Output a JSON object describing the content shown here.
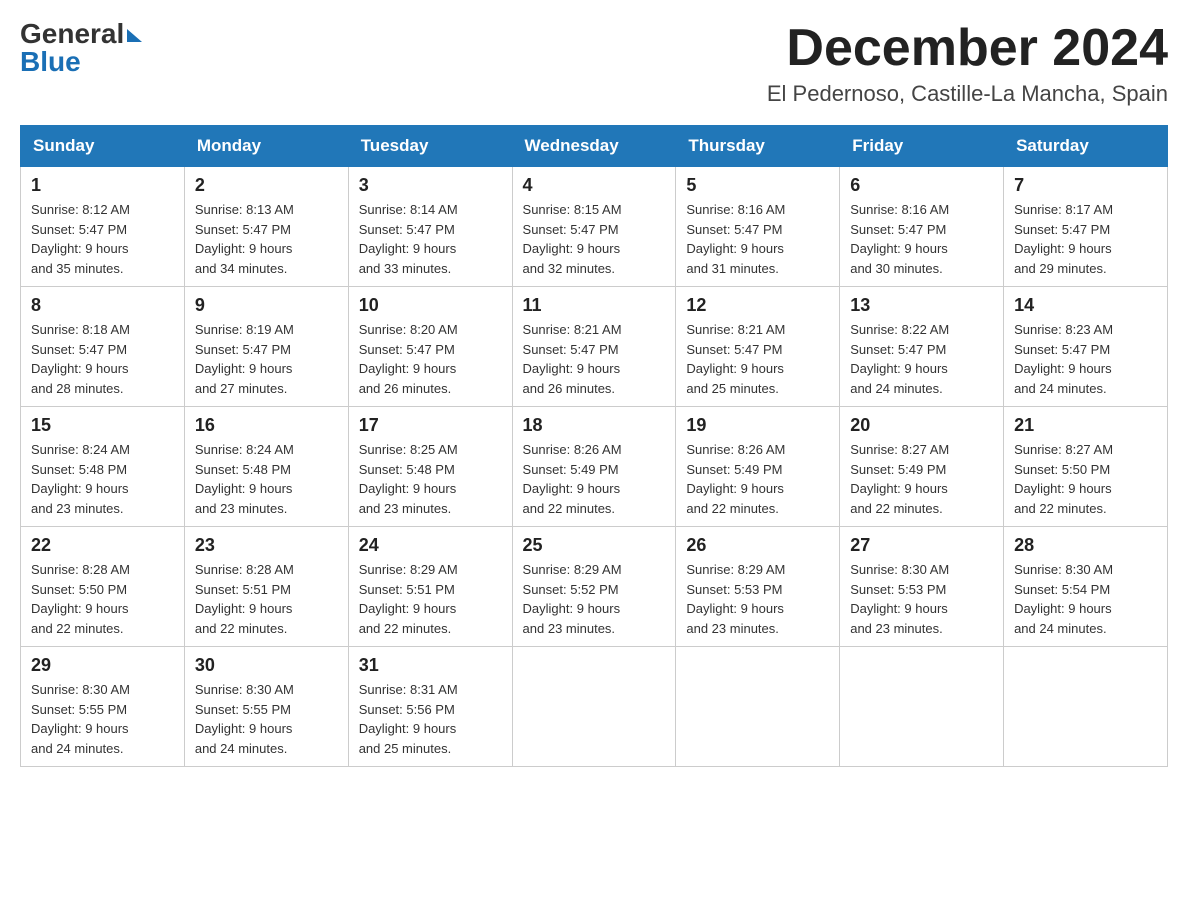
{
  "header": {
    "logo_general": "General",
    "logo_blue": "Blue",
    "month_title": "December 2024",
    "location": "El Pedernoso, Castille-La Mancha, Spain"
  },
  "days_of_week": [
    "Sunday",
    "Monday",
    "Tuesday",
    "Wednesday",
    "Thursday",
    "Friday",
    "Saturday"
  ],
  "weeks": [
    [
      {
        "day": "1",
        "sunrise": "8:12 AM",
        "sunset": "5:47 PM",
        "daylight": "9 hours and 35 minutes."
      },
      {
        "day": "2",
        "sunrise": "8:13 AM",
        "sunset": "5:47 PM",
        "daylight": "9 hours and 34 minutes."
      },
      {
        "day": "3",
        "sunrise": "8:14 AM",
        "sunset": "5:47 PM",
        "daylight": "9 hours and 33 minutes."
      },
      {
        "day": "4",
        "sunrise": "8:15 AM",
        "sunset": "5:47 PM",
        "daylight": "9 hours and 32 minutes."
      },
      {
        "day": "5",
        "sunrise": "8:16 AM",
        "sunset": "5:47 PM",
        "daylight": "9 hours and 31 minutes."
      },
      {
        "day": "6",
        "sunrise": "8:16 AM",
        "sunset": "5:47 PM",
        "daylight": "9 hours and 30 minutes."
      },
      {
        "day": "7",
        "sunrise": "8:17 AM",
        "sunset": "5:47 PM",
        "daylight": "9 hours and 29 minutes."
      }
    ],
    [
      {
        "day": "8",
        "sunrise": "8:18 AM",
        "sunset": "5:47 PM",
        "daylight": "9 hours and 28 minutes."
      },
      {
        "day": "9",
        "sunrise": "8:19 AM",
        "sunset": "5:47 PM",
        "daylight": "9 hours and 27 minutes."
      },
      {
        "day": "10",
        "sunrise": "8:20 AM",
        "sunset": "5:47 PM",
        "daylight": "9 hours and 26 minutes."
      },
      {
        "day": "11",
        "sunrise": "8:21 AM",
        "sunset": "5:47 PM",
        "daylight": "9 hours and 26 minutes."
      },
      {
        "day": "12",
        "sunrise": "8:21 AM",
        "sunset": "5:47 PM",
        "daylight": "9 hours and 25 minutes."
      },
      {
        "day": "13",
        "sunrise": "8:22 AM",
        "sunset": "5:47 PM",
        "daylight": "9 hours and 24 minutes."
      },
      {
        "day": "14",
        "sunrise": "8:23 AM",
        "sunset": "5:47 PM",
        "daylight": "9 hours and 24 minutes."
      }
    ],
    [
      {
        "day": "15",
        "sunrise": "8:24 AM",
        "sunset": "5:48 PM",
        "daylight": "9 hours and 23 minutes."
      },
      {
        "day": "16",
        "sunrise": "8:24 AM",
        "sunset": "5:48 PM",
        "daylight": "9 hours and 23 minutes."
      },
      {
        "day": "17",
        "sunrise": "8:25 AM",
        "sunset": "5:48 PM",
        "daylight": "9 hours and 23 minutes."
      },
      {
        "day": "18",
        "sunrise": "8:26 AM",
        "sunset": "5:49 PM",
        "daylight": "9 hours and 22 minutes."
      },
      {
        "day": "19",
        "sunrise": "8:26 AM",
        "sunset": "5:49 PM",
        "daylight": "9 hours and 22 minutes."
      },
      {
        "day": "20",
        "sunrise": "8:27 AM",
        "sunset": "5:49 PM",
        "daylight": "9 hours and 22 minutes."
      },
      {
        "day": "21",
        "sunrise": "8:27 AM",
        "sunset": "5:50 PM",
        "daylight": "9 hours and 22 minutes."
      }
    ],
    [
      {
        "day": "22",
        "sunrise": "8:28 AM",
        "sunset": "5:50 PM",
        "daylight": "9 hours and 22 minutes."
      },
      {
        "day": "23",
        "sunrise": "8:28 AM",
        "sunset": "5:51 PM",
        "daylight": "9 hours and 22 minutes."
      },
      {
        "day": "24",
        "sunrise": "8:29 AM",
        "sunset": "5:51 PM",
        "daylight": "9 hours and 22 minutes."
      },
      {
        "day": "25",
        "sunrise": "8:29 AM",
        "sunset": "5:52 PM",
        "daylight": "9 hours and 23 minutes."
      },
      {
        "day": "26",
        "sunrise": "8:29 AM",
        "sunset": "5:53 PM",
        "daylight": "9 hours and 23 minutes."
      },
      {
        "day": "27",
        "sunrise": "8:30 AM",
        "sunset": "5:53 PM",
        "daylight": "9 hours and 23 minutes."
      },
      {
        "day": "28",
        "sunrise": "8:30 AM",
        "sunset": "5:54 PM",
        "daylight": "9 hours and 24 minutes."
      }
    ],
    [
      {
        "day": "29",
        "sunrise": "8:30 AM",
        "sunset": "5:55 PM",
        "daylight": "9 hours and 24 minutes."
      },
      {
        "day": "30",
        "sunrise": "8:30 AM",
        "sunset": "5:55 PM",
        "daylight": "9 hours and 24 minutes."
      },
      {
        "day": "31",
        "sunrise": "8:31 AM",
        "sunset": "5:56 PM",
        "daylight": "9 hours and 25 minutes."
      },
      null,
      null,
      null,
      null
    ]
  ],
  "labels": {
    "sunrise": "Sunrise:",
    "sunset": "Sunset:",
    "daylight": "Daylight:"
  }
}
